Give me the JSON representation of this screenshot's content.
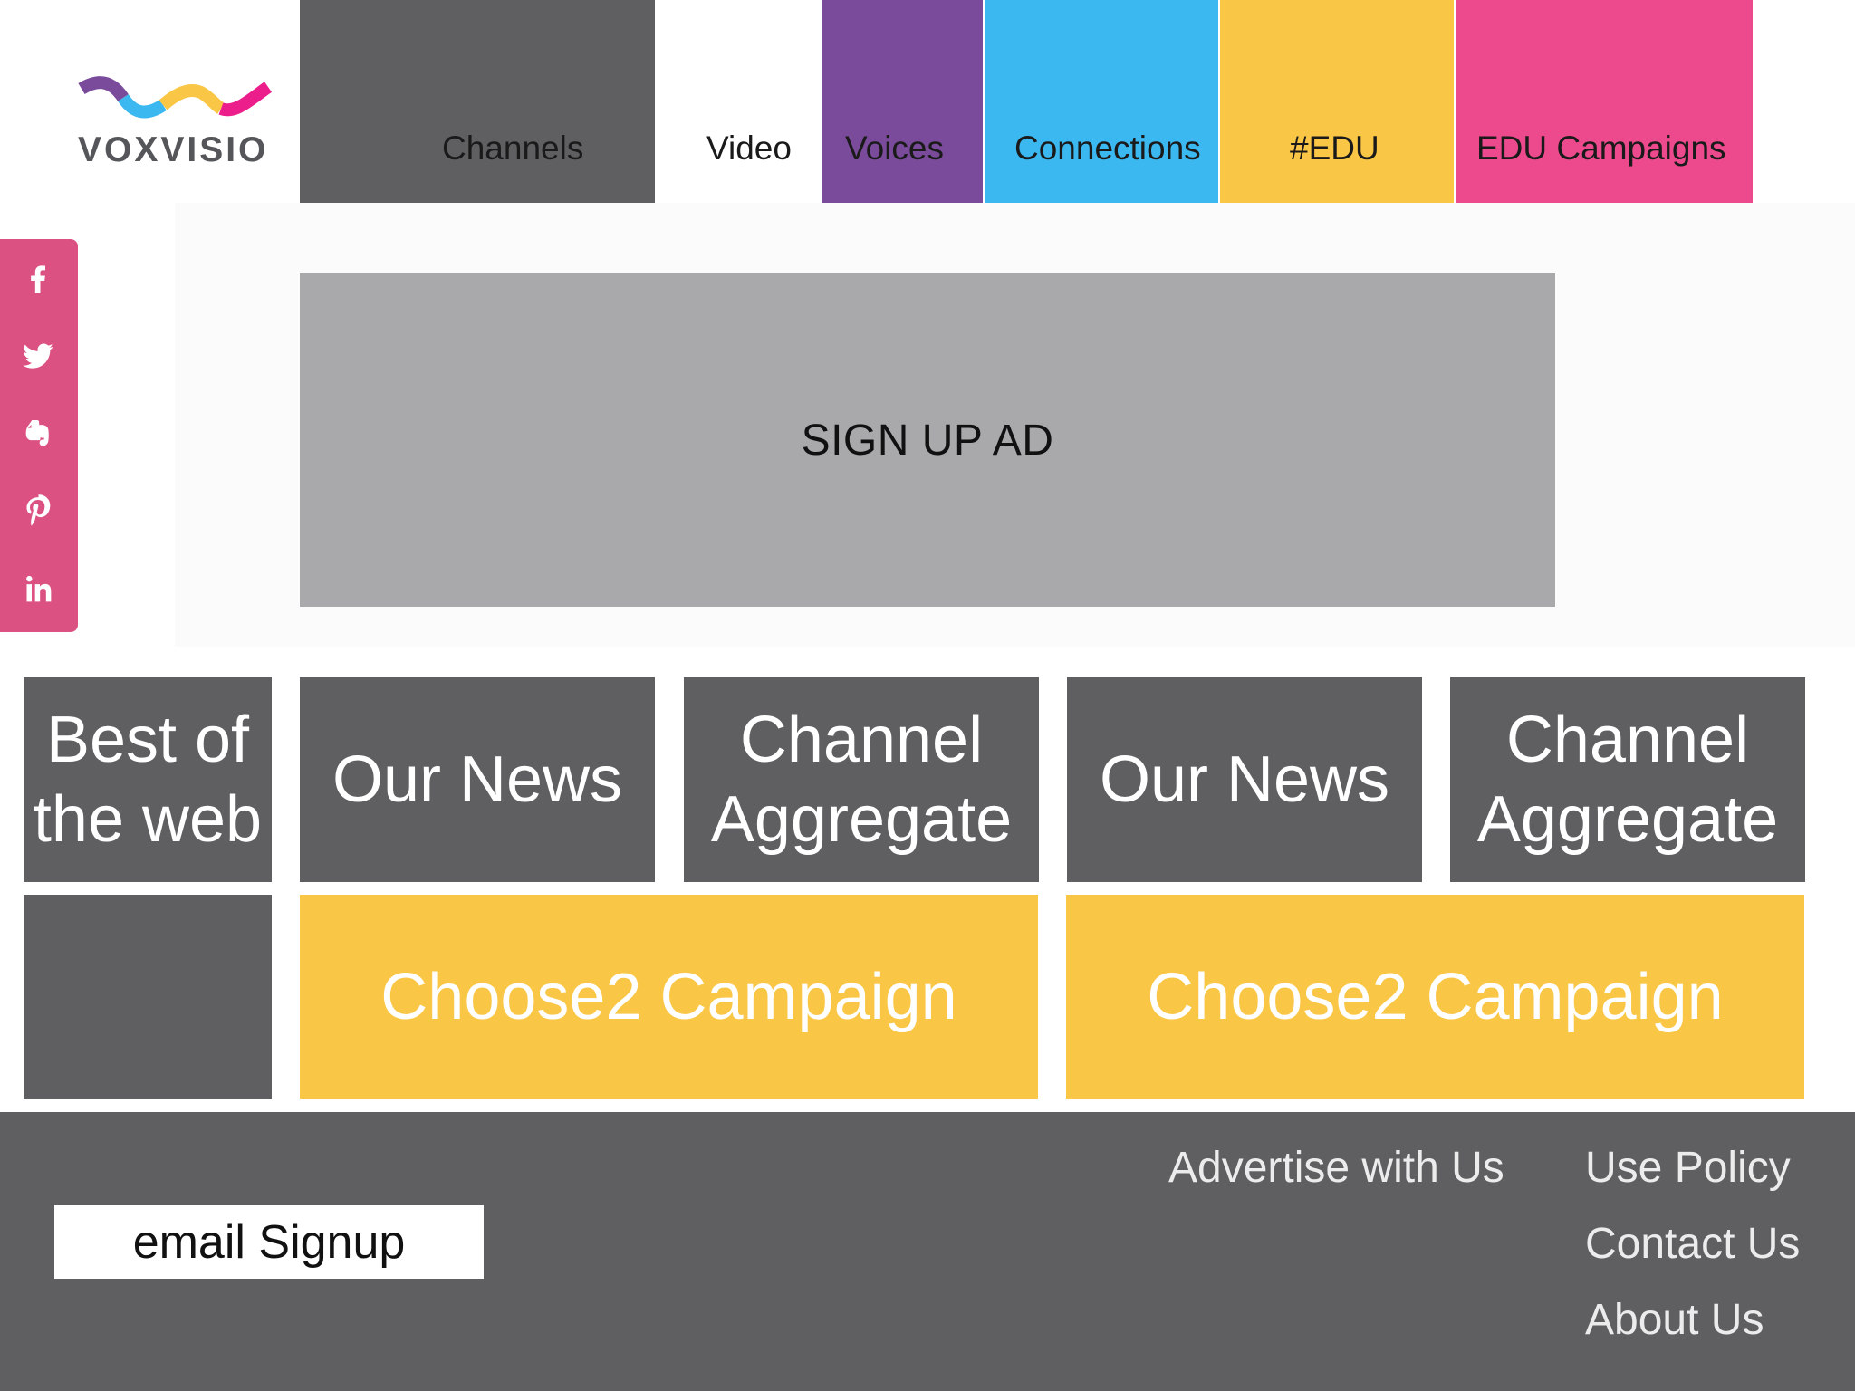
{
  "brand": {
    "name": "VOXVISIO",
    "colors": {
      "purple": "#7a4b9a",
      "blue": "#3cb8f0",
      "yellow": "#fac646",
      "pink": "#ec4a8c",
      "dark_gray": "#5f5e61"
    }
  },
  "nav": {
    "tabs": [
      {
        "label": "Channels",
        "color": "#5f5e61"
      },
      {
        "label": "Video",
        "color": "#ffffff"
      },
      {
        "label": "Voices",
        "color": "#7a4b9a"
      },
      {
        "label": "Connections",
        "color": "#3cb8f0"
      },
      {
        "label": "#EDU",
        "color": "#fac646"
      },
      {
        "label": "EDU Campaigns",
        "color": "#ec4a8c"
      }
    ]
  },
  "social": {
    "icons": [
      "facebook-icon",
      "twitter-icon",
      "evernote-icon",
      "pinterest-icon",
      "linkedin-icon"
    ],
    "bar_color": "#db5282"
  },
  "ad": {
    "label": "SIGN UP AD"
  },
  "tiles": {
    "row1": [
      {
        "line1": "Best of",
        "line2": "the web"
      },
      {
        "line1": "Our News",
        "line2": ""
      },
      {
        "line1": "Channel",
        "line2": "Aggregate"
      },
      {
        "line1": "Our News",
        "line2": ""
      },
      {
        "line1": "Channel",
        "line2": "Aggregate"
      }
    ],
    "row2": [
      {
        "label": ""
      },
      {
        "label": "Choose2 Campaign"
      },
      {
        "label": "Choose2 Campaign"
      }
    ]
  },
  "footer": {
    "email_signup": "email Signup",
    "links": {
      "advertise": "Advertise with Us",
      "use_policy": "Use Policy",
      "contact": "Contact Us",
      "about": "About Us"
    }
  }
}
